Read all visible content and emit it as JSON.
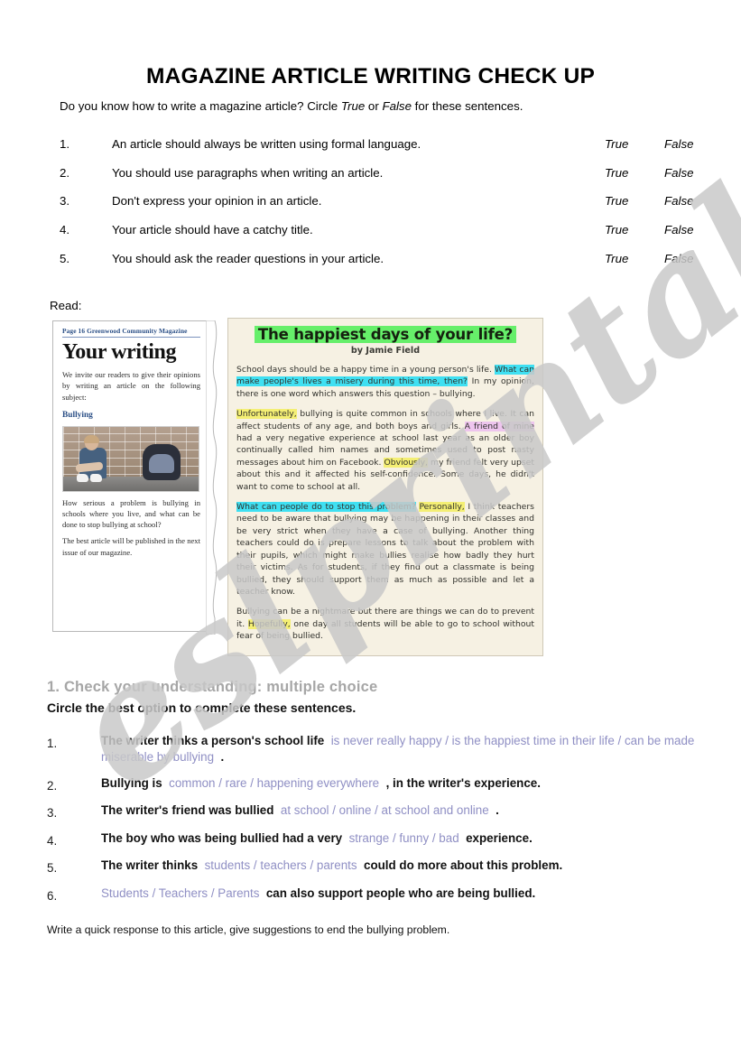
{
  "title": "MAGAZINE ARTICLE WRITING CHECK UP",
  "intro": {
    "before": "Do you know how to write a magazine article? Circle ",
    "true_word": "True",
    "middle": " or ",
    "false_word": "False",
    "after": " for these sentences."
  },
  "true_false": {
    "true_label": "True",
    "false_label": "False",
    "items": [
      {
        "num": "1.",
        "text": "An article should always be written using formal language."
      },
      {
        "num": "2.",
        "text": "You should use paragraphs when writing an article."
      },
      {
        "num": "3.",
        "text": "Don't express your opinion in an article."
      },
      {
        "num": "4.",
        "text": "Your article should have a catchy title."
      },
      {
        "num": "5.",
        "text": "You should ask the reader questions in your article."
      }
    ]
  },
  "read_label": "Read:",
  "clipping": {
    "header": "Page 16   Greenwood Community Magazine",
    "title": "Your writing",
    "invite": "We invite our readers to give their opinions by writing an article on the following subject:",
    "subject": "Bullying",
    "photo_alt": "boy sitting against brick wall beside backpack",
    "question": "How serious a problem is bullying in schools where you live, and what can be done to stop bullying at school?",
    "closing": "The best article will be published in the next issue of our magazine."
  },
  "article": {
    "title": "The happiest days of your life?",
    "byline": "by Jamie Field",
    "paragraphs": [
      [
        {
          "t": "School days should be a happy time in a young person's life. ",
          "h": "none"
        },
        {
          "t": "What can make people's lives a misery during this time, then?",
          "h": "cyan"
        },
        {
          "t": " In my opinion, there is one word which answers this question – bullying.",
          "h": "none"
        }
      ],
      [
        {
          "t": "Unfortunately,",
          "h": "yellow"
        },
        {
          "t": " bullying is quite common in schools where I live. It can affect students of any age, and both boys and girls. ",
          "h": "none"
        },
        {
          "t": "A friend of mine",
          "h": "pink"
        },
        {
          "t": " had a very negative experience at school last year as an older boy continually called him names and sometimes used to post nasty messages about him on Facebook. ",
          "h": "none"
        },
        {
          "t": "Obviously,",
          "h": "yellow"
        },
        {
          "t": " my friend felt very upset about this and it affected his self-confidence. Some days, he didn't want to come to school at all.",
          "h": "none"
        }
      ],
      [
        {
          "t": "What can people do to stop this problem?",
          "h": "cyan"
        },
        {
          "t": " ",
          "h": "none"
        },
        {
          "t": "Personally,",
          "h": "yellow"
        },
        {
          "t": " I think teachers need to be aware that bullying may be happening in their classes and be very strict when they have a case of bullying. Another thing teachers could do is prepare lessons to talk about the problem with their pupils, which might make bullies realise how badly they hurt their victims. As for students, if they find out a classmate is being bullied, they should support them as much as possible and let a teacher know.",
          "h": "none"
        }
      ],
      [
        {
          "t": "Bullying can be a nightmare but there are things we can do to prevent it. ",
          "h": "none"
        },
        {
          "t": "Hopefully,",
          "h": "yellow"
        },
        {
          "t": " one day all students will be able to go to school without fear of being bullied.",
          "h": "none"
        }
      ]
    ]
  },
  "multiple_choice": {
    "heading": "1. Check your understanding: multiple choice",
    "instruction": "Circle the best option to complete these sentences.",
    "items": [
      {
        "num": "1.",
        "stem": "The writer thinks a person's school life",
        "options": "is never really happy / is the happiest time in their life / can be made miserable by bullying",
        "tail": "."
      },
      {
        "num": "2.",
        "stem": "Bullying is",
        "options": "common / rare / happening everywhere",
        "tail": ", in the writer's experience."
      },
      {
        "num": "3.",
        "stem": "The writer's friend was bullied",
        "options": "at school / online / at school and online",
        "tail": "."
      },
      {
        "num": "4.",
        "stem": "The boy who was being bullied had a very",
        "options": "strange / funny / bad",
        "tail": "experience."
      },
      {
        "num": "5.",
        "stem": "The writer thinks",
        "options": "students / teachers / parents",
        "tail": "could do more about this problem."
      },
      {
        "num": "6.",
        "stem": "",
        "options": "Students / Teachers / Parents",
        "tail": "can also support people who are being bullied."
      }
    ]
  },
  "footer": "Write a quick response to this article, give suggestions to end the bullying problem.",
  "watermark": {
    "text": "eslprintables.com",
    "color": "#c9c9c9"
  }
}
